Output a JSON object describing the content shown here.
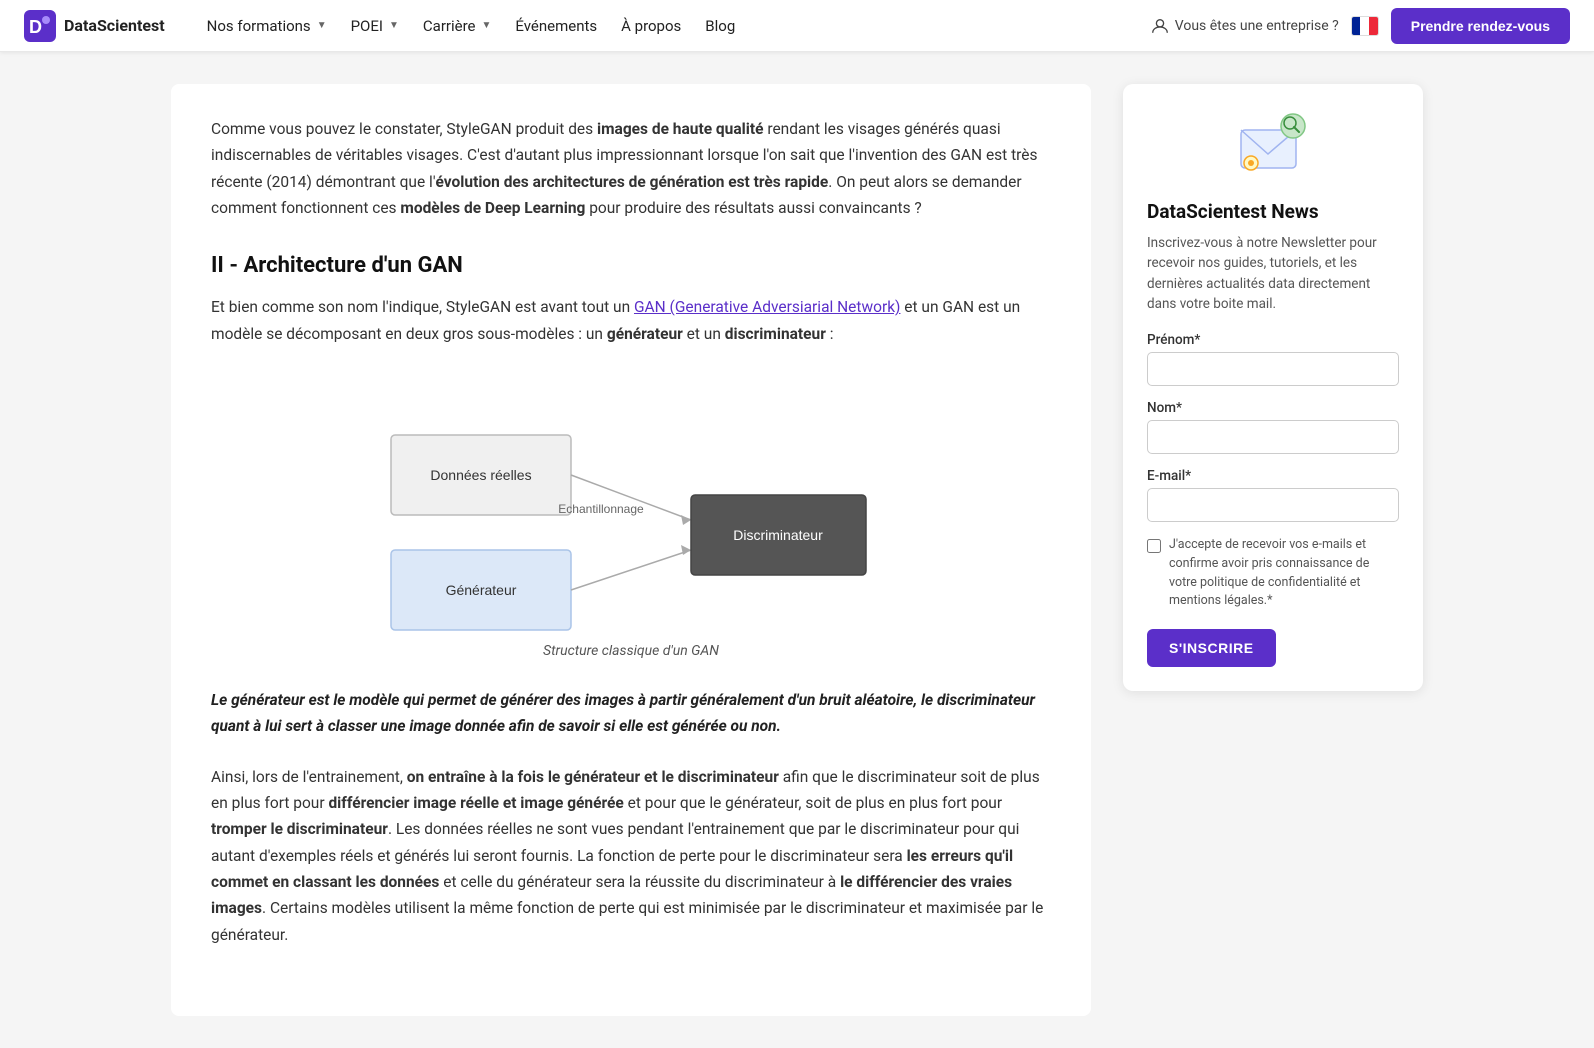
{
  "header": {
    "logo_text": "DataScientest",
    "nav": [
      {
        "label": "Nos formations",
        "has_dropdown": true
      },
      {
        "label": "POEI",
        "has_dropdown": true
      },
      {
        "label": "Carrière",
        "has_dropdown": true
      },
      {
        "label": "Événements",
        "has_dropdown": false
      },
      {
        "label": "À propos",
        "has_dropdown": false
      },
      {
        "label": "Blog",
        "has_dropdown": false
      }
    ],
    "enterprise_label": "Vous êtes une entreprise ?",
    "cta_label": "Prendre rendez-vous"
  },
  "article": {
    "intro_text_1": "Comme vous pouvez le constater, StyleGAN produit des ",
    "intro_bold_1": "images de haute qualité",
    "intro_text_2": " rendant les visages générés quasi indiscernables de véritables visages. C'est d'autant plus impressionnant lorsque l'on sait que l'invention des GAN est très récente (2014) démontrant que l'",
    "intro_bold_2": "évolution des architectures de génération est très rapide",
    "intro_text_3": ". On peut alors se demander comment fonctionnent ces ",
    "intro_bold_3": "modèles de Deep Learning",
    "intro_text_4": " pour produire des résultats aussi convaincants ?",
    "section_heading": "II - Architecture d'un GAN",
    "section_text_1": "Et bien comme son nom l'indique, StyleGAN est avant tout un ",
    "section_link": "GAN (Generative Adversiarial Network)",
    "section_text_2": " et un GAN est un modèle se décomposant en deux gros sous-modèles : un ",
    "section_bold_1": "générateur",
    "section_text_3": " et un ",
    "section_bold_2": "discriminateur",
    "section_text_4": " :",
    "diagram_caption": "Structure classique d'un GAN",
    "diagram": {
      "box1_label": "Données réelles",
      "box2_label": "Générateur",
      "box3_label": "Discriminateur",
      "arrow_label": "Echantillonnage"
    },
    "blockquote": "Le générateur est le modèle qui permet de générer des images à partir généralement d'un bruit aléatoire, le discriminateur quant à lui sert à classer une image donnée afin de savoir si elle est générée ou non.",
    "body_text_1": "Ainsi, lors de l'entrainement, ",
    "body_bold_1": "on entraîne à la fois le générateur et le discriminateur",
    "body_text_2": " afin que le discriminateur soit de plus en plus fort pour ",
    "body_bold_2": "différencier image réelle et image générée",
    "body_text_3": " et pour que le générateur, soit de plus en plus fort pour ",
    "body_bold_3": "tromper le discriminateur",
    "body_text_4": ". Les données réelles ne sont vues pendant l'entrainement que par le discriminateur pour qui autant d'exemples réels et générés lui seront fournis. La fonction de perte pour le discriminateur sera ",
    "body_bold_4": "les erreurs qu'il commet en classant les données",
    "body_text_5": " et celle du générateur sera la réussite du discriminateur à ",
    "body_bold_5": "le différencier des vraies images",
    "body_text_6": ". Certains modèles utilisent la même fonction de perte qui est minimisée par le discriminateur et maximisée par le générateur."
  },
  "sidebar": {
    "title": "DataScientest News",
    "description": "Inscrivez-vous à notre Newsletter pour recevoir nos guides, tutoriels, et les dernières actualités data directement dans votre boite mail.",
    "form": {
      "prenom_label": "Prénom*",
      "prenom_placeholder": "",
      "nom_label": "Nom*",
      "nom_placeholder": "",
      "email_label": "E-mail*",
      "email_placeholder": "",
      "checkbox_text": "J'accepte de recevoir vos e-mails et confirme avoir pris connaissance de votre politique de confidentialité et mentions légales.*",
      "subscribe_label": "S'INSCRIRE"
    }
  }
}
